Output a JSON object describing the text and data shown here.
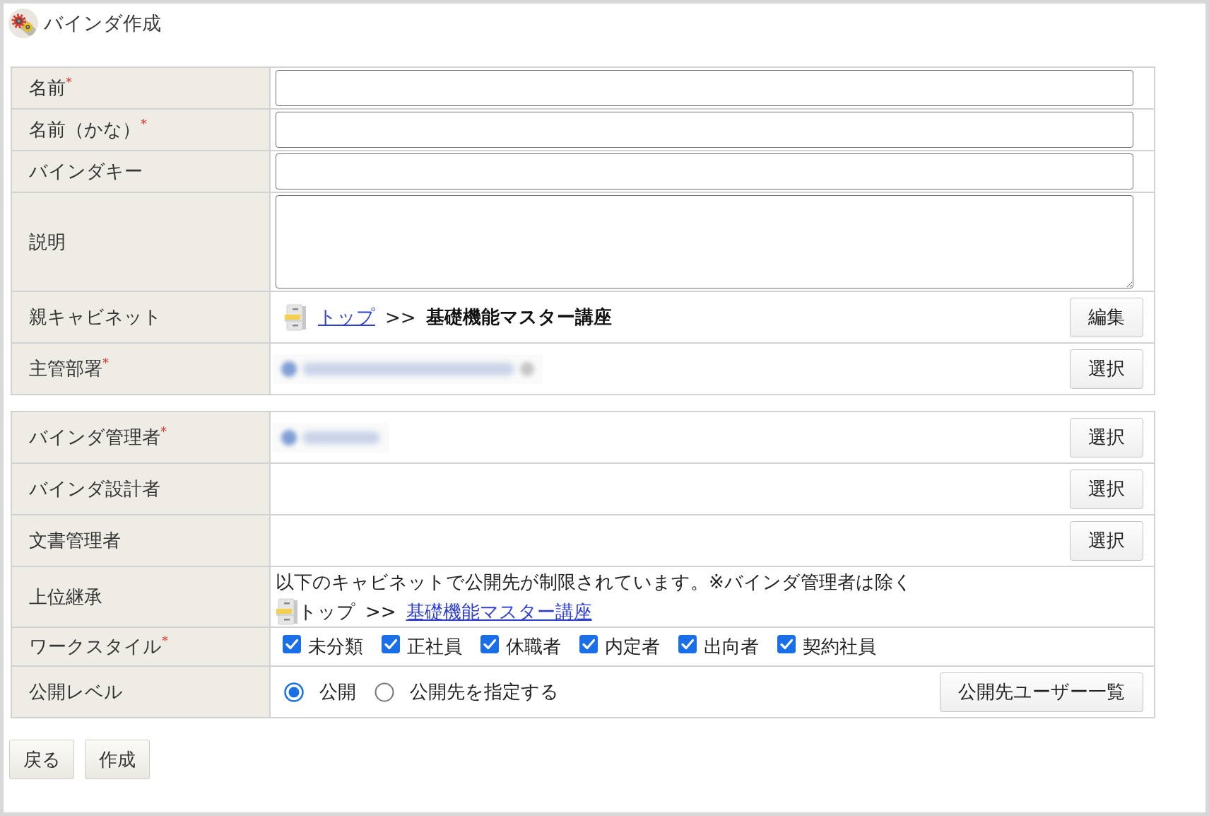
{
  "header": {
    "title": "バインダ作成"
  },
  "sections": [
    {
      "rows": [
        {
          "label": "名前",
          "required_mark": "*",
          "kind": "text"
        },
        {
          "label": "名前（かな）",
          "required_mark": "*",
          "kind": "text"
        },
        {
          "label": "バインダキー",
          "kind": "text"
        },
        {
          "label": "説明",
          "kind": "textarea"
        },
        {
          "label": "親キャビネット",
          "kind": "cabinet",
          "path": [
            {
              "kind": "link",
              "text": "トップ"
            },
            {
              "kind": "separator",
              "text": ">>"
            },
            {
              "kind": "bold",
              "text": "基礎機能マスター講座"
            }
          ],
          "button": "編集"
        },
        {
          "label": "主管部署",
          "required_mark": "*",
          "kind": "picker",
          "redacted": true,
          "button": "選択"
        }
      ]
    },
    {
      "rows": [
        {
          "label": "バインダ管理者",
          "required_mark": "*",
          "kind": "picker",
          "redacted": true,
          "button": "選択"
        },
        {
          "label": "バインダ設計者",
          "kind": "picker",
          "redacted": false,
          "button": "選択"
        },
        {
          "label": "文書管理者",
          "kind": "picker",
          "redacted": false,
          "button": "選択"
        },
        {
          "label": "上位継承",
          "kind": "inherit",
          "note": "以下のキャビネットで公開先が制限されています。※バインダ管理者は除く",
          "path": [
            {
              "kind": "plain",
              "text": "トップ"
            },
            {
              "kind": "separator",
              "text": ">>"
            },
            {
              "kind": "link",
              "text": "基礎機能マスター講座"
            }
          ]
        },
        {
          "label": "ワークスタイル",
          "required_mark": "*",
          "kind": "checkboxes",
          "options": [
            {
              "label": "未分類",
              "checked": true
            },
            {
              "label": "正社員",
              "checked": true
            },
            {
              "label": "休職者",
              "checked": true
            },
            {
              "label": "内定者",
              "checked": true
            },
            {
              "label": "出向者",
              "checked": true
            },
            {
              "label": "契約社員",
              "checked": true
            }
          ]
        },
        {
          "label": "公開レベル",
          "kind": "radios",
          "options": [
            {
              "label": "公開",
              "selected": true
            },
            {
              "label": "公開先を指定する",
              "selected": false
            }
          ],
          "button": "公開先ユーザー一覧"
        }
      ]
    }
  ],
  "footer_buttons": [
    "戻る",
    "作成"
  ]
}
